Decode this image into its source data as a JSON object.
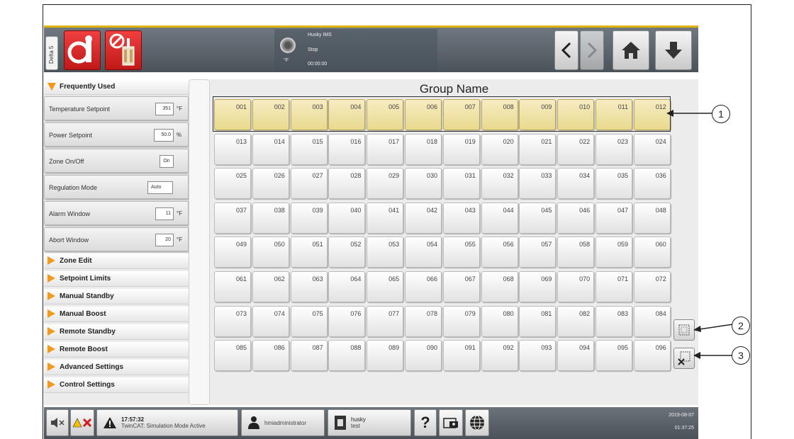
{
  "header": {
    "delta_tab": "Delta 5",
    "status_title": "Husky IMS",
    "status_state": "Stop",
    "status_time": "00:00:00",
    "status_unit": "°F"
  },
  "sidebar": {
    "frequently_used": "Frequently Used",
    "settings": [
      {
        "label": "Temperature Setpoint",
        "value": "351",
        "unit": "°F"
      },
      {
        "label": "Power Setpoint",
        "value": "50.0",
        "unit": "%"
      },
      {
        "label": "Zone On/Off",
        "value": "On",
        "unit": ""
      },
      {
        "label": "Regulation Mode",
        "value": "Auto",
        "unit": ""
      },
      {
        "label": "Alarm Window",
        "value": "11",
        "unit": "°F"
      },
      {
        "label": "Abort Window",
        "value": "20",
        "unit": "°F"
      }
    ],
    "sections": [
      "Zone Edit",
      "Setpoint Limits",
      "Manual Standby",
      "Manual Boost",
      "Remote Standby",
      "Remote Boost",
      "Advanced Settings",
      "Control Settings"
    ]
  },
  "main": {
    "title": "Group Name",
    "zones": [
      "001",
      "002",
      "003",
      "004",
      "005",
      "006",
      "007",
      "008",
      "009",
      "010",
      "011",
      "012",
      "013",
      "014",
      "015",
      "016",
      "017",
      "018",
      "019",
      "020",
      "021",
      "022",
      "023",
      "024",
      "025",
      "026",
      "027",
      "028",
      "029",
      "030",
      "031",
      "032",
      "033",
      "034",
      "035",
      "036",
      "037",
      "038",
      "039",
      "040",
      "041",
      "042",
      "043",
      "044",
      "045",
      "046",
      "047",
      "048",
      "049",
      "050",
      "051",
      "052",
      "053",
      "054",
      "055",
      "056",
      "057",
      "058",
      "059",
      "060",
      "061",
      "062",
      "063",
      "064",
      "065",
      "066",
      "067",
      "068",
      "069",
      "070",
      "071",
      "072",
      "073",
      "074",
      "075",
      "076",
      "077",
      "078",
      "079",
      "080",
      "081",
      "082",
      "083",
      "084",
      "085",
      "086",
      "087",
      "088",
      "089",
      "090",
      "091",
      "092",
      "093",
      "094",
      "095",
      "096"
    ],
    "selected_zones": [
      "001",
      "002",
      "003",
      "004",
      "005",
      "006",
      "007",
      "008",
      "009",
      "010",
      "011",
      "012"
    ]
  },
  "callouts": [
    "1",
    "2",
    "3"
  ],
  "footer": {
    "alarm_time": "17:57:32",
    "alarm_message": "TwinCAT: Simulation Mode Active",
    "user": "hmiadministrator",
    "mold_name": "husky",
    "mold_sub": "test",
    "help": "?",
    "date": "2019-08-07",
    "time": "01:37:25"
  },
  "colors": {
    "accent": "#e0b400",
    "selected_zone": "#ecdc95",
    "alarm_red": "#d01c1c",
    "expander": "#f29a1c"
  },
  "icons": [
    "mold-alarm-icon",
    "mold-disabled-icon",
    "back-icon",
    "forward-icon",
    "home-icon",
    "download-icon",
    "mute-icon",
    "alarm-icon",
    "user-icon",
    "mold-icon",
    "help-icon",
    "screenshot-icon",
    "globe-icon",
    "select-all-icon",
    "clear-selection-icon"
  ]
}
